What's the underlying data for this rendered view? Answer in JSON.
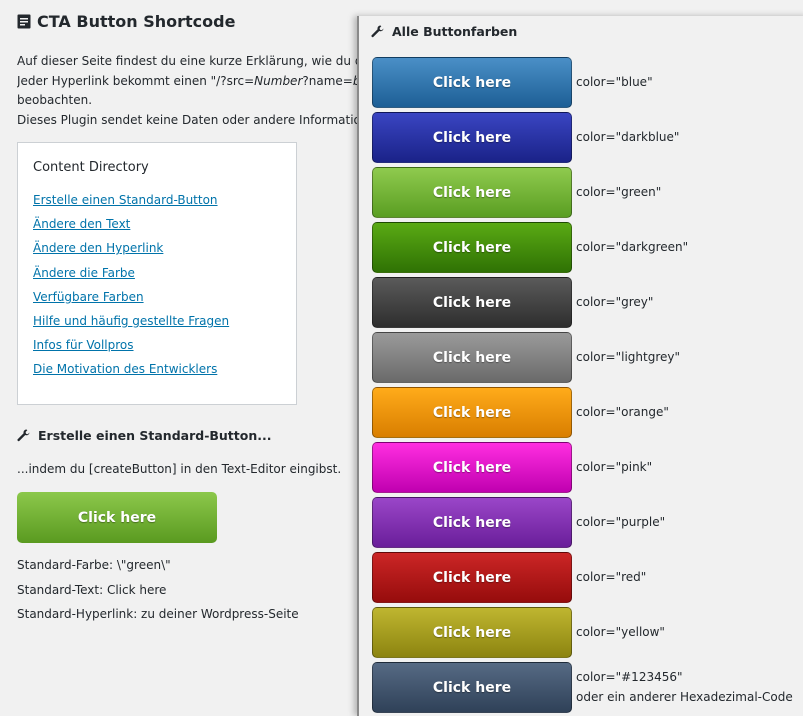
{
  "page": {
    "title": "CTA Button Shortcode",
    "intro_line1": "Auf dieser Seite findest du eine kurze Erklärung, wie du de",
    "intro_line2_prefix": "Jeder Hyperlink bekommt einen \"/?src=",
    "intro_line2_em1": "Number",
    "intro_line2_mid": "?name=",
    "intro_line2_em2": "butt",
    "intro_line3": "beobachten.",
    "intro_line4": "Dieses Plugin sendet keine Daten oder andere Information"
  },
  "toc": {
    "title": "Content Directory",
    "items": [
      "Erstelle einen Standard-Button",
      "Ändere den Text",
      "Ändere den Hyperlink",
      "Ändere die Farbe",
      "Verfügbare Farben",
      "Hilfe und häufig gestellte Fragen",
      "Infos für Vollpros",
      "Die Motivation des Entwicklers"
    ]
  },
  "section": {
    "heading": "Erstelle einen Standard-Button...",
    "text": "...indem du [createButton] in den Text-Editor eingibst.",
    "button_label": "Click here",
    "default_color": "Standard-Farbe: \\\"green\\\"",
    "default_text": "Standard-Text: Click here",
    "default_link": "Standard-Hyperlink: zu deiner Wordpress-Seite"
  },
  "panel": {
    "title": "Alle Buttonfarben",
    "buttons": [
      {
        "label": "Click here",
        "code": "color=\"blue\"",
        "top": "#4a8fc7",
        "bottom": "#1d5f96"
      },
      {
        "label": "Click here",
        "code": "color=\"darkblue\"",
        "top": "#3a45c2",
        "bottom": "#1a2288"
      },
      {
        "label": "Click here",
        "code": "color=\"green\"",
        "top": "#8fca4e",
        "bottom": "#5a9e22"
      },
      {
        "label": "Click here",
        "code": "color=\"darkgreen\"",
        "top": "#5aaa14",
        "bottom": "#2f7204"
      },
      {
        "label": "Click here",
        "code": "color=\"grey\"",
        "top": "#5a5a5a",
        "bottom": "#2e2e2e"
      },
      {
        "label": "Click here",
        "code": "color=\"lightgrey\"",
        "top": "#9a9a9a",
        "bottom": "#6a6a6a"
      },
      {
        "label": "Click here",
        "code": "color=\"orange\"",
        "top": "#ffab1a",
        "bottom": "#d97e00"
      },
      {
        "label": "Click here",
        "code": "color=\"pink\"",
        "top": "#ff2ee0",
        "bottom": "#c000b0"
      },
      {
        "label": "Click here",
        "code": "color=\"purple\"",
        "top": "#9a46c8",
        "bottom": "#6a1e9a"
      },
      {
        "label": "Click here",
        "code": "color=\"red\"",
        "top": "#cc2626",
        "bottom": "#960c0c"
      },
      {
        "label": "Click here",
        "code": "color=\"yellow\"",
        "top": "#bfb630",
        "bottom": "#8c8410"
      },
      {
        "label": "Click here",
        "code": "color=\"#123456\"",
        "code2": "oder ein anderer Hexadezimal-Code",
        "top": "#566a84",
        "bottom": "#2f4158"
      }
    ]
  },
  "colors": {
    "link": "#0073aa",
    "main_button_top": "#8cc84b",
    "main_button_bottom": "#5a9a20"
  }
}
